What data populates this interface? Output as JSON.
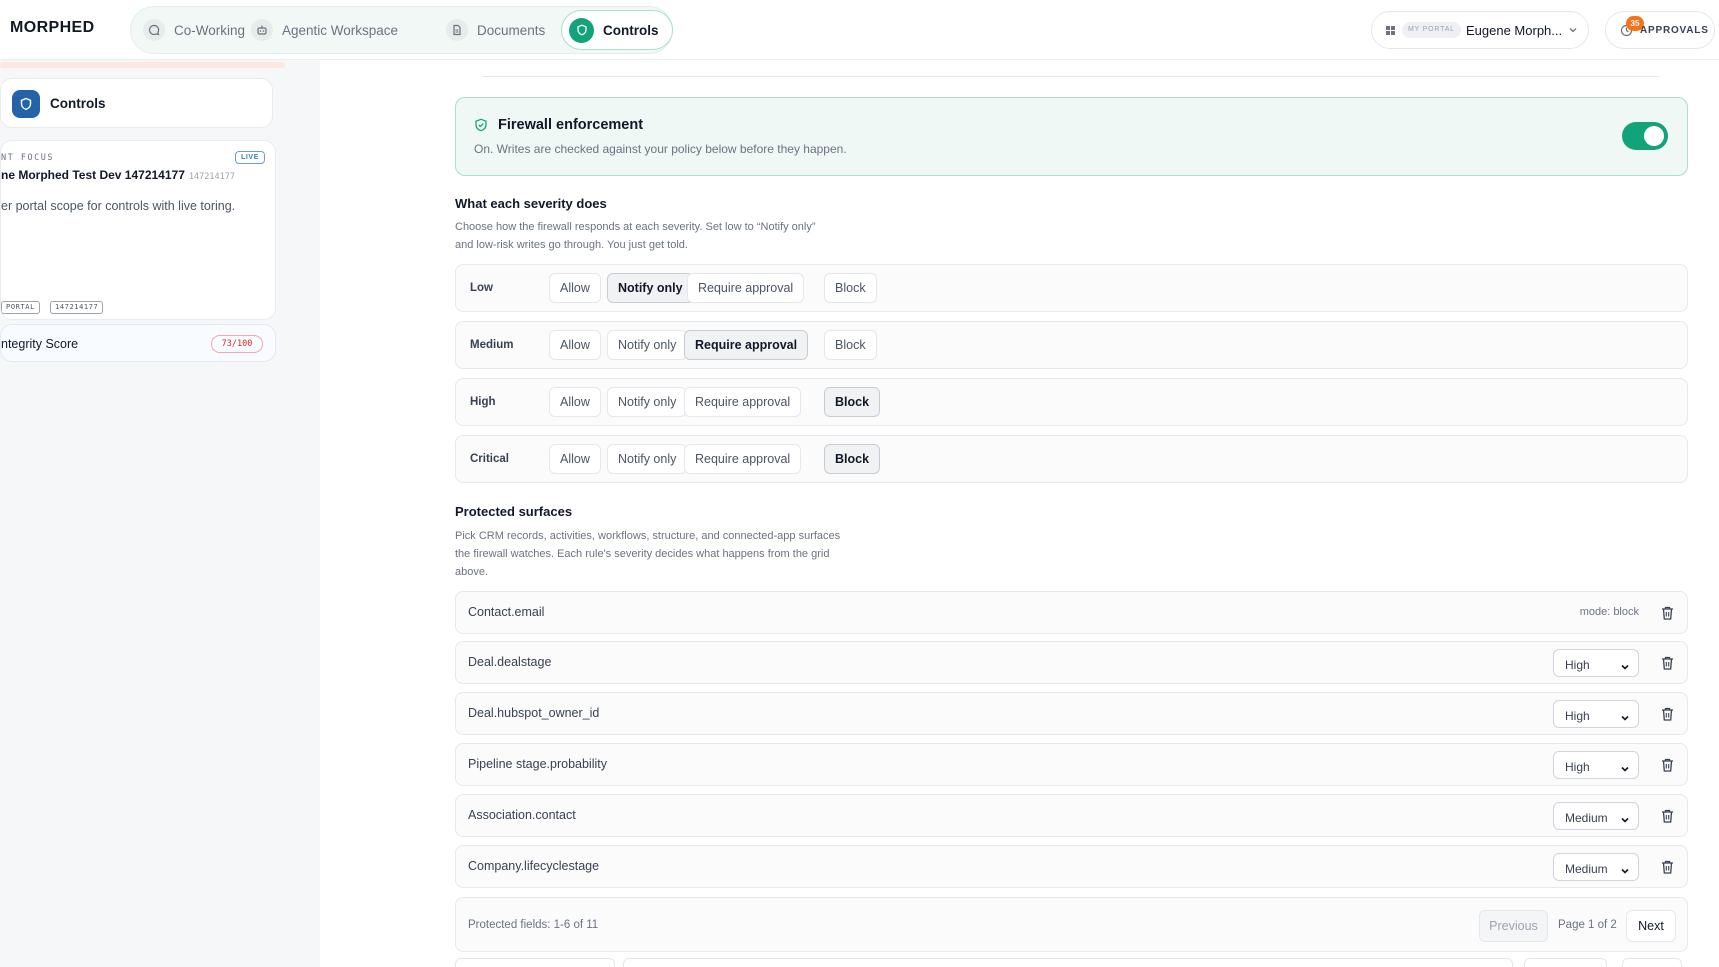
{
  "app": {
    "logo": "MORPHED"
  },
  "nav": {
    "tabs": [
      {
        "label": "Co-Working",
        "icon": "chat-icon"
      },
      {
        "label": "Agentic Workspace",
        "icon": "robot-icon"
      },
      {
        "label": "Documents",
        "icon": "document-icon"
      },
      {
        "label": "Controls",
        "icon": "shield-icon",
        "active": true
      }
    ]
  },
  "user": {
    "portal_tag": "MY PORTAL",
    "name": "Eugene Morph..."
  },
  "approvals": {
    "label": "APPROVALS",
    "count": "35"
  },
  "sidebar": {
    "controls_label": "Controls",
    "card": {
      "focus_label": "NT FOCUS",
      "live_badge": "LIVE",
      "portal_name": "ne Morphed Test Dev 147214177",
      "portal_id": "147214177",
      "description": "er portal scope for controls with live toring.",
      "tags": [
        "PORTAL",
        "147214177"
      ]
    },
    "integrity": {
      "label": "ntegrity Score",
      "score": "73/100"
    }
  },
  "firewall": {
    "title": "Firewall enforcement",
    "subtitle": "On. Writes are checked against your policy below before they happen.",
    "enabled": true
  },
  "severity": {
    "title": "What each severity does",
    "description_line1": "Choose how the firewall responds at each severity. Set low to “Notify only”",
    "description_line2": "and low-risk writes go through. You just get told.",
    "options": [
      "Allow",
      "Notify only",
      "Require approval",
      "Block"
    ],
    "rows": [
      {
        "label": "Low",
        "selected": "Notify only"
      },
      {
        "label": "Medium",
        "selected": "Require approval"
      },
      {
        "label": "High",
        "selected": "Block"
      },
      {
        "label": "Critical",
        "selected": "Block"
      }
    ]
  },
  "surfaces": {
    "title": "Protected surfaces",
    "description_line1": "Pick CRM records, activities, workflows, structure, and connected-app surfaces",
    "description_line2": "the firewall watches. Each rule's severity decides what happens from the grid",
    "description_line3": "above.",
    "rows": [
      {
        "field": "Contact.email",
        "mode": "mode: block"
      },
      {
        "field": "Deal.dealstage",
        "severity": "High"
      },
      {
        "field": "Deal.hubspot_owner_id",
        "severity": "High"
      },
      {
        "field": "Pipeline stage.probability",
        "severity": "High"
      },
      {
        "field": "Association.contact",
        "severity": "Medium"
      },
      {
        "field": "Company.lifecyclestage",
        "severity": "Medium"
      }
    ],
    "pager": {
      "info": "Protected fields: 1-6 of 11",
      "previous": "Previous",
      "page": "Page 1 of 2",
      "next": "Next"
    }
  },
  "colors": {
    "accent": "#12a37a",
    "brand_blue": "#2563a8",
    "badge_orange": "#f97316",
    "score_red": "#dc2626"
  }
}
